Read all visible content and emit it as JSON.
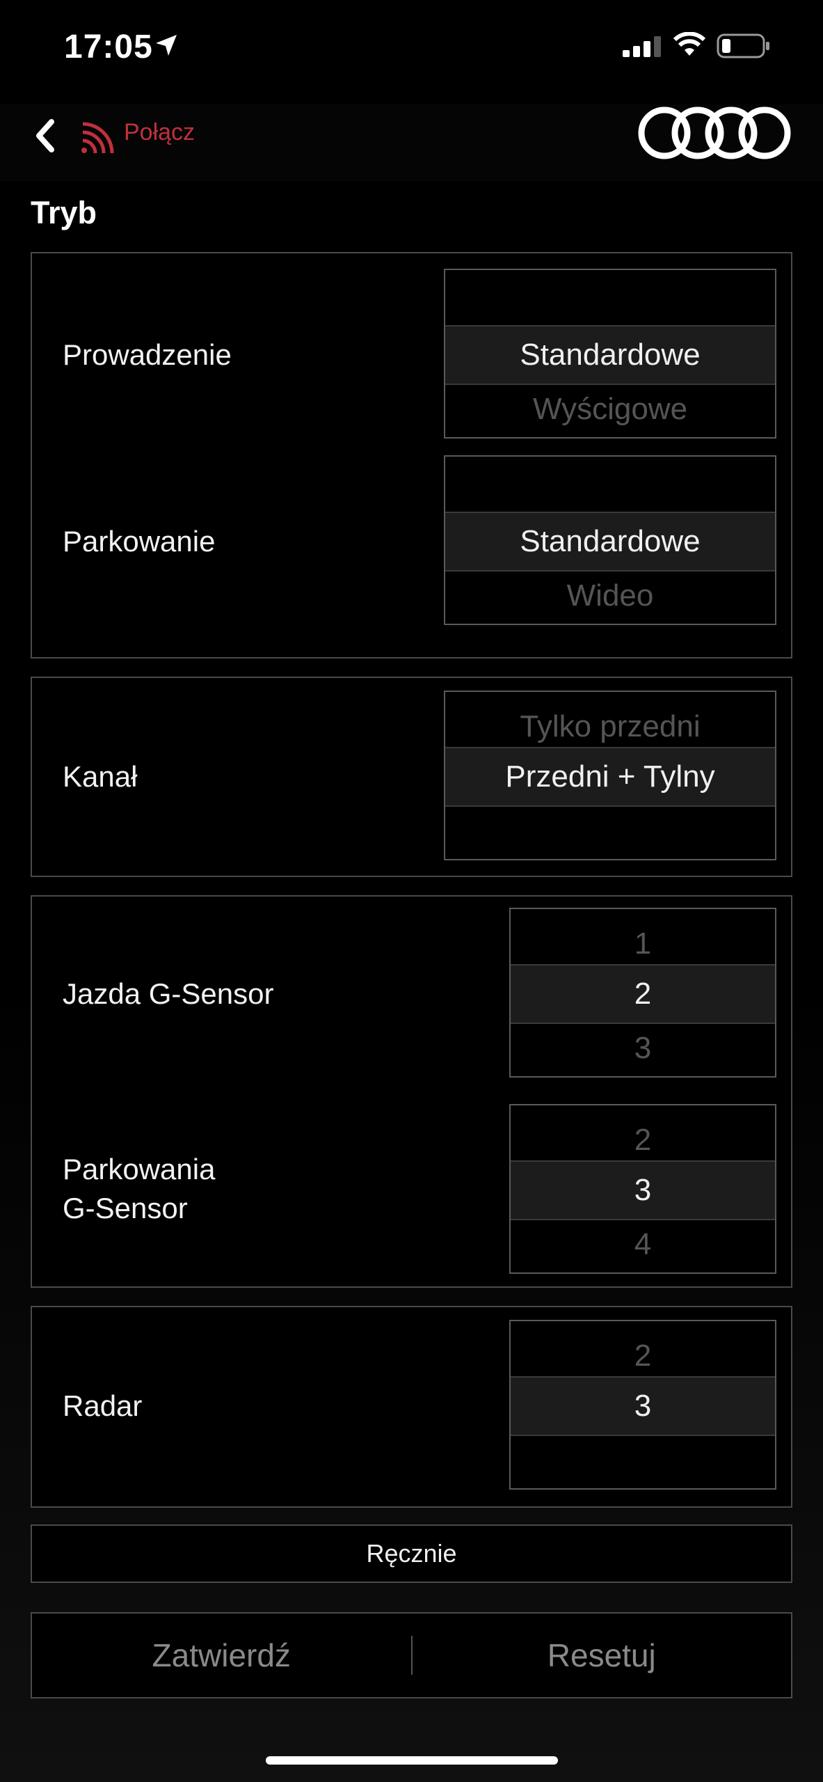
{
  "status_bar": {
    "time": "17:05"
  },
  "nav": {
    "connect_label": "Połącz"
  },
  "section_title": "Tryb",
  "mode_card": {
    "driving": {
      "label": "Prowadzenie",
      "options": [
        "",
        "Standardowe",
        "Wyścigowe"
      ],
      "selected": "Standardowe"
    },
    "parking": {
      "label": "Parkowanie",
      "options": [
        "",
        "Standardowe",
        "Wideo"
      ],
      "selected": "Standardowe"
    }
  },
  "channel_card": {
    "label": "Kanał",
    "options": [
      "Tylko przedni",
      "Przedni + Tylny",
      ""
    ],
    "selected": "Przedni + Tylny"
  },
  "gsensor_card": {
    "driving": {
      "label": "Jazda G-Sensor",
      "options": [
        "1",
        "2",
        "3"
      ],
      "selected": "2"
    },
    "parking": {
      "label_line1": "Parkowania",
      "label_line2": "G-Sensor",
      "options": [
        "2",
        "3",
        "4"
      ],
      "selected": "3"
    }
  },
  "radar_card": {
    "label": "Radar",
    "options": [
      "2",
      "3",
      ""
    ],
    "selected": "3"
  },
  "manual_label": "Ręcznie",
  "actions": {
    "confirm": "Zatwierdź",
    "reset": "Resetuj"
  },
  "colors": {
    "accent_red": "#c0303c",
    "background": "#000000",
    "border": "#4a4a4a"
  }
}
